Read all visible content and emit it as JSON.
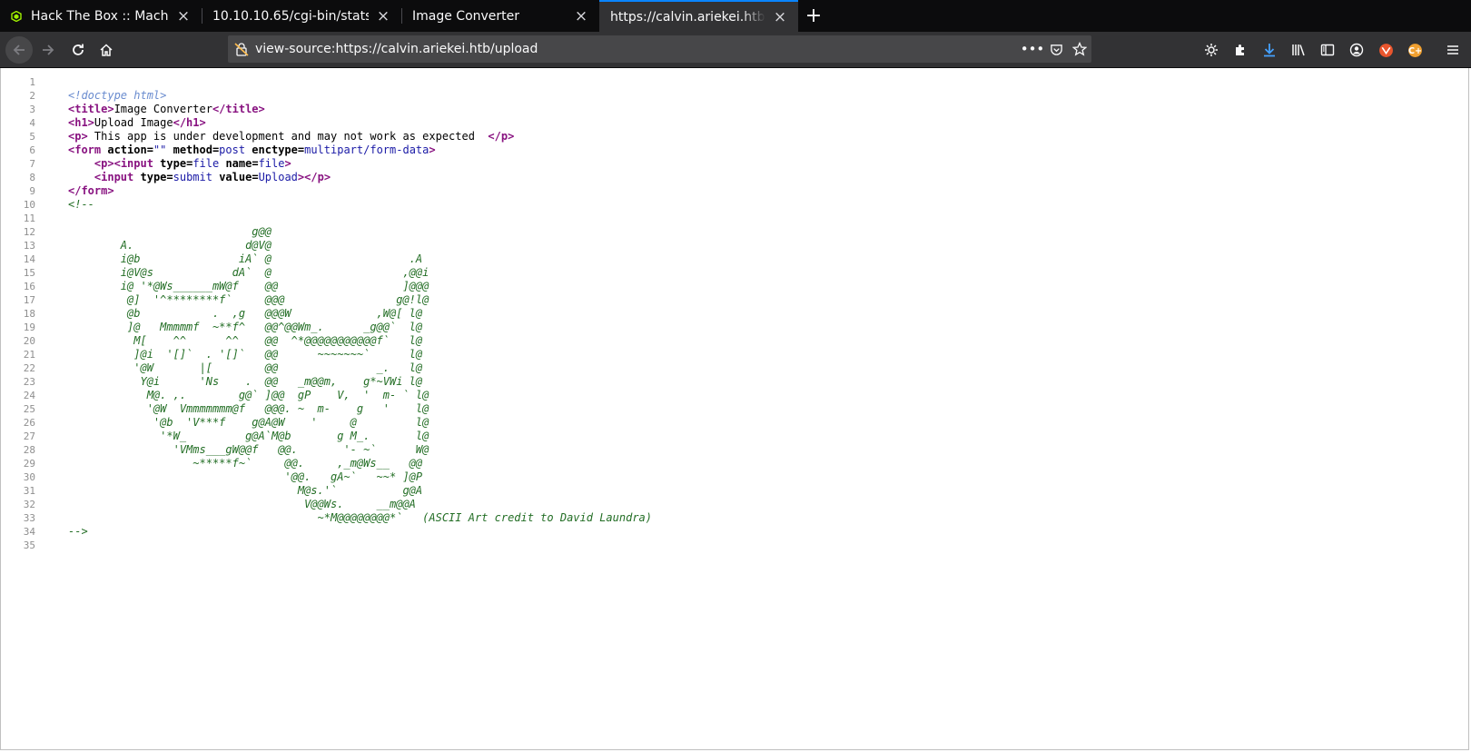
{
  "tabs": [
    {
      "title": "Hack The Box :: Machines",
      "favicon": "htb-cube-icon",
      "active": false
    },
    {
      "title": "10.10.10.65/cgi-bin/stats",
      "favicon": "",
      "active": false
    },
    {
      "title": "Image Converter",
      "favicon": "",
      "active": false
    },
    {
      "title": "https://calvin.ariekei.htb/upload",
      "favicon": "",
      "active": true
    }
  ],
  "new_tab_label": "+",
  "address_bar": {
    "url": "view-source:https://calvin.ariekei.htb/upload"
  },
  "toolbar_icons": [
    "settings-icon",
    "extensions-icon",
    "download-icon",
    "library-icon",
    "sidebar-icon",
    "account-icon",
    "fox-extension-icon",
    "cookie-extension-icon",
    "menu-icon"
  ],
  "source": {
    "line_numbers": [
      "1",
      "2",
      "3",
      "4",
      "5",
      "6",
      "7",
      "8",
      "9",
      "10",
      "11",
      "12",
      "13",
      "14",
      "15",
      "16",
      "17",
      "18",
      "19",
      "20",
      "21",
      "22",
      "23",
      "24",
      "25",
      "26",
      "27",
      "28",
      "29",
      "30",
      "31",
      "32",
      "33",
      "34",
      "35"
    ],
    "doctype": "<!doctype html>",
    "title_open": "<title>",
    "title_text": "Image Converter",
    "title_close": "</title>",
    "h1_open": "<h1>",
    "h1_text": "Upload Image",
    "h1_close": "</h1>",
    "p_open": "<p>",
    "p_text": " This app is under development and may not work as expected  ",
    "p_close": "</p>",
    "form_open": "<form",
    "action_attr": " action=",
    "action_val": "\"\"",
    "method_attr": " method=",
    "method_val": "post",
    "enctype_attr": " enctype=",
    "enctype_val": "multipart/form-data",
    "form_gt": ">",
    "indent": "    ",
    "p_tag": "<p>",
    "input_open": "<input",
    "type_attr": " type=",
    "type_file": "file",
    "name_attr": " name=",
    "name_val": "file",
    "input_gt": ">",
    "type_submit": "submit",
    "value_attr": " value=",
    "value_val": "Upload",
    "input_gt_close": "></p>",
    "form_close": "</form>",
    "comment_open": "<!--",
    "ascii_art": [
      "",
      "                            g@@",
      "        A.                 d@V@",
      "        i@b               iA` @                     .A",
      "        i@V@s            dA`  @                    ,@@i",
      "        i@ '*@Ws______mW@f    @@                   ]@@@",
      "         @]  '^********f`     @@@                 g@!l@",
      "         @b           .  ,g   @@@W             ,W@[ l@",
      "         ]@   Mmmmmf  ~**f^   @@^@@Wm_.      _g@@`  l@",
      "          M[    ^^      ^^    @@  ^*@@@@@@@@@@@f`   l@",
      "          ]@i  '[]`  . '[]`   @@      ~~~~~~~`      l@",
      "          '@W       |[        @@               _.   l@",
      "           Y@i      'Ns    .  @@   _m@@m,    g*~VWi l@",
      "            M@. ,.        g@` ]@@  gP    V,  '  m- ` l@",
      "            '@W  Vmmmmmmm@f   @@@. ~  m-    g   '    l@",
      "             '@b  'V***f    g@A@W    '     @         l@",
      "              '*W_         g@A`M@b       g M_.       l@",
      "                'VMms___gW@@f   @@.       '- ~`      W@",
      "                   ~*****f~`     @@.     ,_m@Ws__   @@",
      "                                 '@@.   gA~`   ~~* ]@P",
      "                                   M@s.'`          g@A",
      "                                    V@@Ws.     __m@@A",
      "                                      ~*M@@@@@@@@*`"
    ],
    "ascii_credit": "   (ASCII Art credit to David Laundra)",
    "comment_close": "-->"
  }
}
